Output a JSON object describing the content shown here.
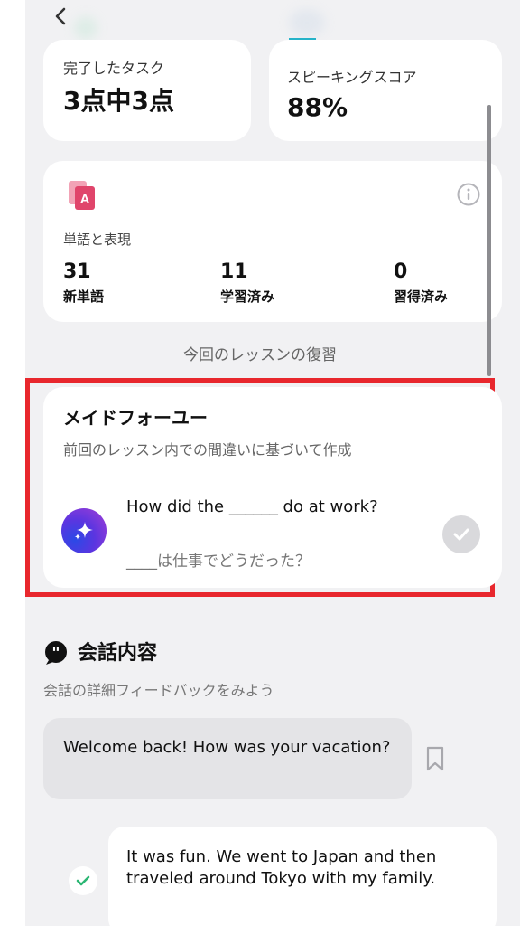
{
  "nav": {
    "back_icon": "chevron-left-icon"
  },
  "stats": {
    "completed_label": "完了したタスク",
    "completed_value": "3点中3点",
    "speaking_label": "スピーキングスコア",
    "speaking_value": "88%"
  },
  "vocab": {
    "title": "単語と表現",
    "items": [
      {
        "num": "31",
        "label": "新単語"
      },
      {
        "num": "11",
        "label": "学習済み"
      },
      {
        "num": "0",
        "label": "習得済み"
      }
    ]
  },
  "review_heading": "今回のレッスンの復習",
  "made_for_you": {
    "title": "メイドフォーユー",
    "subtitle": "前回のレッスン内での間違いに基づいて作成",
    "question": "How did the ______ do at work?",
    "translation": "____は仕事でどうだった？"
  },
  "conversation": {
    "title": "会話内容",
    "subtitle": "会話の詳細フィードバックをみよう",
    "ai_message": "Welcome back! How was your vacation?",
    "user_message": "It was fun. We went to Japan and then traveled around Tokyo with my family."
  },
  "colors": {
    "accent_red": "#e8272d",
    "vocab_icon_pink": "#e0456b",
    "check_green": "#2bb673",
    "background": "#f1f1f3"
  }
}
